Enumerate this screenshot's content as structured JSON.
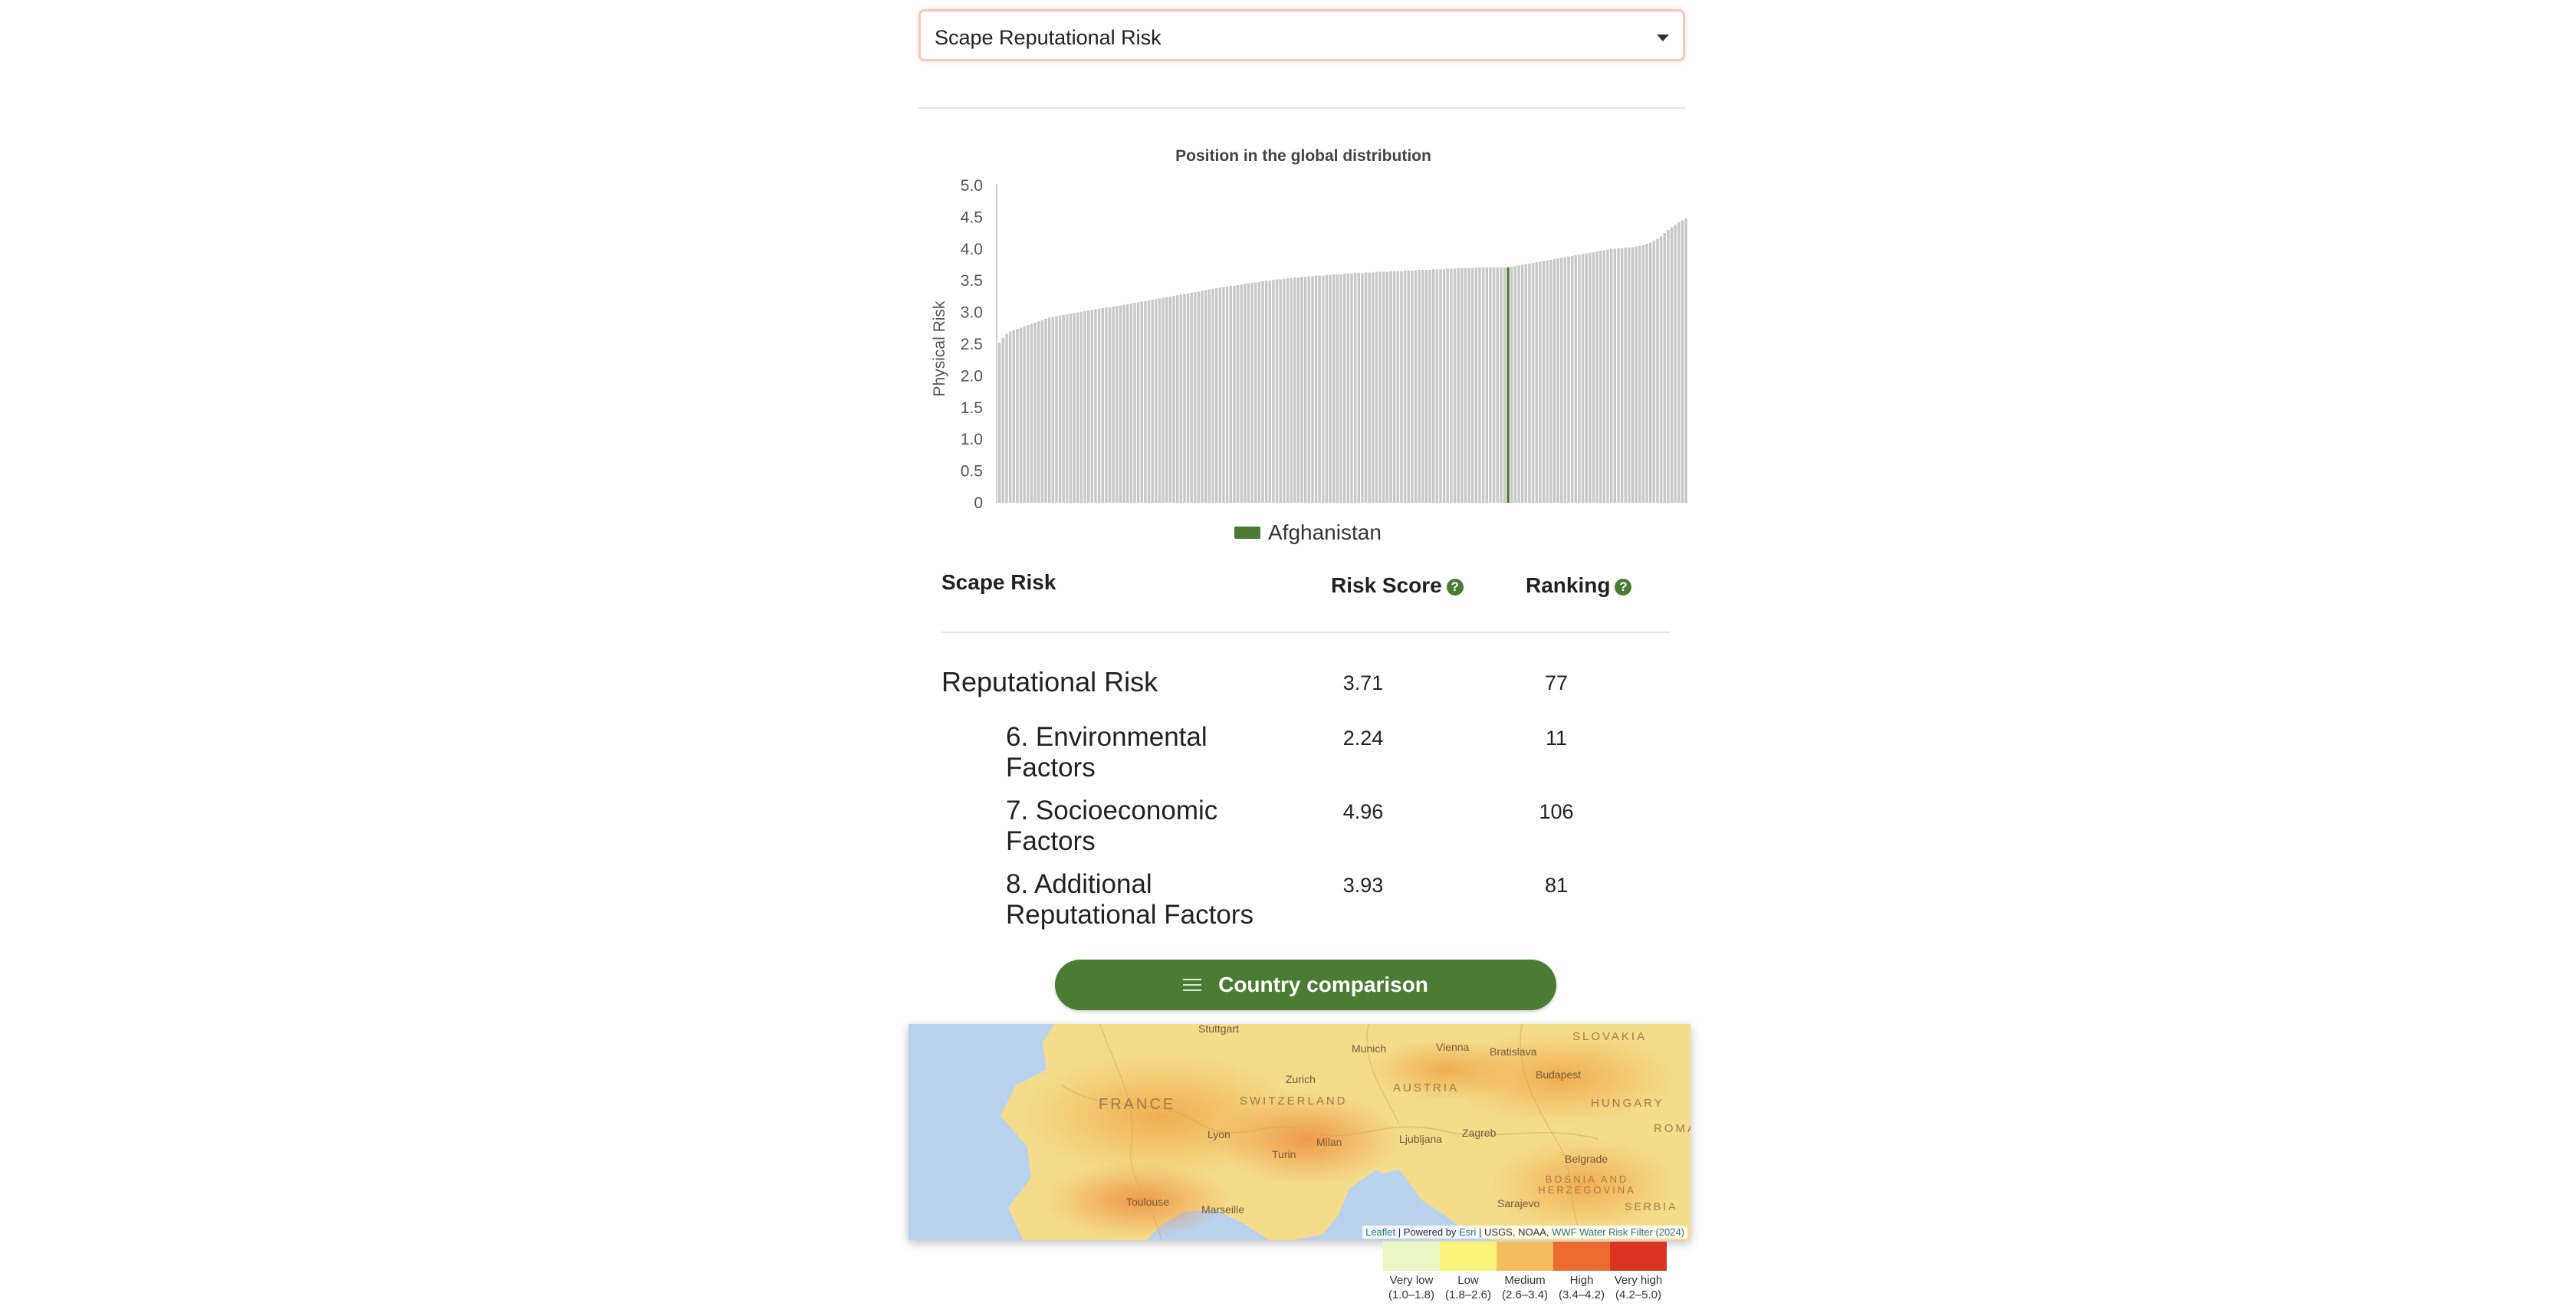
{
  "dropdown": {
    "selected": "Scape Reputational Risk"
  },
  "chart_data": {
    "type": "bar",
    "title": "Position in the global distribution",
    "ylabel": "Physical Risk",
    "xlabel": "",
    "ylim": [
      0,
      5
    ],
    "yticks": [
      "5.0",
      "4.5",
      "4.0",
      "3.5",
      "3.0",
      "2.5",
      "2.0",
      "1.5",
      "1.0",
      "0.5",
      "0"
    ],
    "count": 192,
    "highlight_index": 143,
    "highlight_name": "Afghanistan",
    "bar_color": "#c8c8c8",
    "highlight_color": "#4a7c34",
    "grid": false,
    "legend": "bottom",
    "values": [
      2.52,
      2.6,
      2.66,
      2.7,
      2.72,
      2.74,
      2.76,
      2.78,
      2.8,
      2.82,
      2.84,
      2.86,
      2.88,
      2.9,
      2.92,
      2.93,
      2.94,
      2.95,
      2.96,
      2.97,
      2.98,
      2.99,
      3.0,
      3.01,
      3.02,
      3.03,
      3.04,
      3.05,
      3.06,
      3.07,
      3.08,
      3.08,
      3.09,
      3.1,
      3.11,
      3.12,
      3.13,
      3.14,
      3.15,
      3.16,
      3.17,
      3.18,
      3.19,
      3.2,
      3.21,
      3.22,
      3.23,
      3.24,
      3.25,
      3.26,
      3.27,
      3.28,
      3.29,
      3.3,
      3.31,
      3.32,
      3.33,
      3.34,
      3.35,
      3.36,
      3.37,
      3.38,
      3.39,
      3.4,
      3.41,
      3.42,
      3.42,
      3.43,
      3.44,
      3.45,
      3.46,
      3.47,
      3.47,
      3.48,
      3.49,
      3.5,
      3.5,
      3.51,
      3.52,
      3.52,
      3.53,
      3.54,
      3.54,
      3.55,
      3.55,
      3.56,
      3.56,
      3.57,
      3.57,
      3.58,
      3.58,
      3.58,
      3.59,
      3.59,
      3.6,
      3.6,
      3.6,
      3.61,
      3.61,
      3.61,
      3.62,
      3.62,
      3.62,
      3.63,
      3.63,
      3.63,
      3.64,
      3.64,
      3.64,
      3.64,
      3.65,
      3.65,
      3.65,
      3.65,
      3.66,
      3.66,
      3.66,
      3.66,
      3.67,
      3.67,
      3.67,
      3.67,
      3.68,
      3.68,
      3.68,
      3.68,
      3.69,
      3.69,
      3.69,
      3.7,
      3.7,
      3.7,
      3.7,
      3.7,
      3.71,
      3.71,
      3.71,
      3.71,
      3.71,
      3.71,
      3.71,
      3.71,
      3.71,
      3.71,
      3.72,
      3.73,
      3.74,
      3.75,
      3.76,
      3.77,
      3.78,
      3.79,
      3.8,
      3.81,
      3.82,
      3.83,
      3.84,
      3.85,
      3.86,
      3.87,
      3.88,
      3.89,
      3.9,
      3.91,
      3.92,
      3.93,
      3.94,
      3.95,
      3.96,
      3.97,
      3.98,
      3.99,
      4.0,
      4.0,
      4.01,
      4.01,
      4.02,
      4.02,
      4.03,
      4.04,
      4.05,
      4.06,
      4.08,
      4.1,
      4.13,
      4.16,
      4.2,
      4.25,
      4.3,
      4.34,
      4.38,
      4.42,
      4.45,
      4.48
    ]
  },
  "table": {
    "headers": {
      "risk": "Scape Risk",
      "score": "Risk Score",
      "ranking": "Ranking",
      "help": "?"
    },
    "rows": [
      {
        "name": "Reputational Risk",
        "score": "3.71",
        "rank": "77"
      },
      {
        "name": "6. Environmental Factors",
        "score": "2.24",
        "rank": "11"
      },
      {
        "name": "7. Socioeconomic Factors",
        "score": "4.96",
        "rank": "106"
      },
      {
        "name": "8. Additional Reputational Factors",
        "score": "3.93",
        "rank": "81"
      }
    ]
  },
  "button": {
    "label": "Country comparison",
    "icon": "menu-icon"
  },
  "map": {
    "countries": [
      "FRANCE",
      "SWITZERLAND",
      "AUSTRIA",
      "HUNGARY",
      "SLOVAKIA",
      "ROMANIA",
      "BOSNIA AND HERZEGOVINA",
      "SERBIA"
    ],
    "cities": [
      "Stuttgart",
      "Munich",
      "Vienna",
      "Bratislava",
      "Budapest",
      "Zurich",
      "Lyon",
      "Turin",
      "Milan",
      "Ljubljana",
      "Zagreb",
      "Belgrade",
      "Toulouse",
      "Marseille",
      "Sarajevo"
    ],
    "attribution": {
      "leaflet": "Leaflet",
      "sep": " | Powered by ",
      "esri": "Esri",
      "sources": " | USGS, NOAA, ",
      "wwf": "WWF Water Risk Filter (2024)"
    }
  },
  "map_legend": [
    {
      "name": "Very low",
      "range": "(1.0–1.8)",
      "color": "#eaf7c4"
    },
    {
      "name": "Low",
      "range": "(1.8–2.6)",
      "color": "#fbf47a"
    },
    {
      "name": "Medium",
      "range": "(2.6–3.4)",
      "color": "#f2bd5a"
    },
    {
      "name": "High",
      "range": "(3.4–4.2)",
      "color": "#ec6a2e"
    },
    {
      "name": "Very high",
      "range": "(4.2–5.0)",
      "color": "#d8341f"
    }
  ]
}
